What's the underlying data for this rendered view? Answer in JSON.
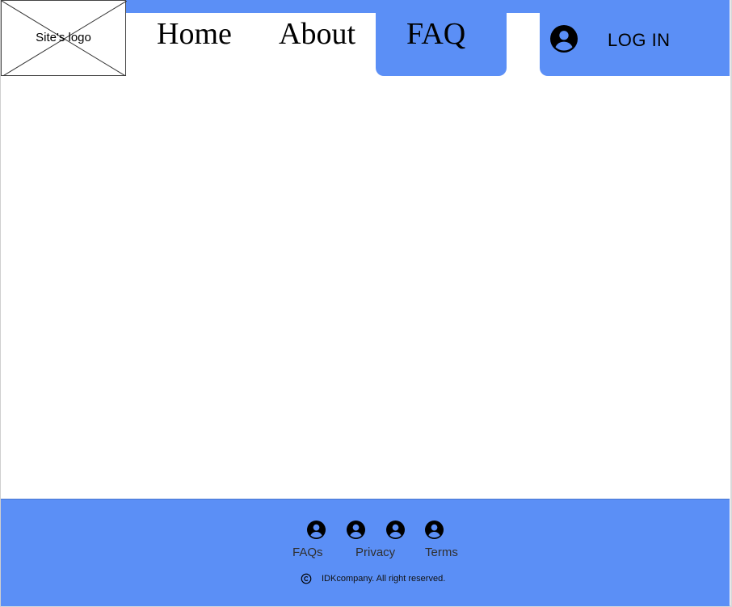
{
  "header": {
    "logo_text": "Site's logo",
    "nav": {
      "home": "Home",
      "about": "About",
      "faq": "FAQ"
    },
    "login": {
      "label": "LOG IN",
      "icon": "user-circle-icon"
    },
    "active_tab": "FAQ"
  },
  "footer": {
    "icons": [
      "user-circle-icon",
      "user-circle-icon",
      "user-circle-icon",
      "user-circle-icon"
    ],
    "links": {
      "faqs": "FAQs",
      "privacy": "Privacy",
      "terms": "Terms"
    },
    "copyright": {
      "icon": "copyright-icon",
      "text": "IDKcompany. All right reserved."
    }
  },
  "colors": {
    "accent": "#5b8ff6",
    "text": "#000000",
    "background": "#ffffff"
  }
}
